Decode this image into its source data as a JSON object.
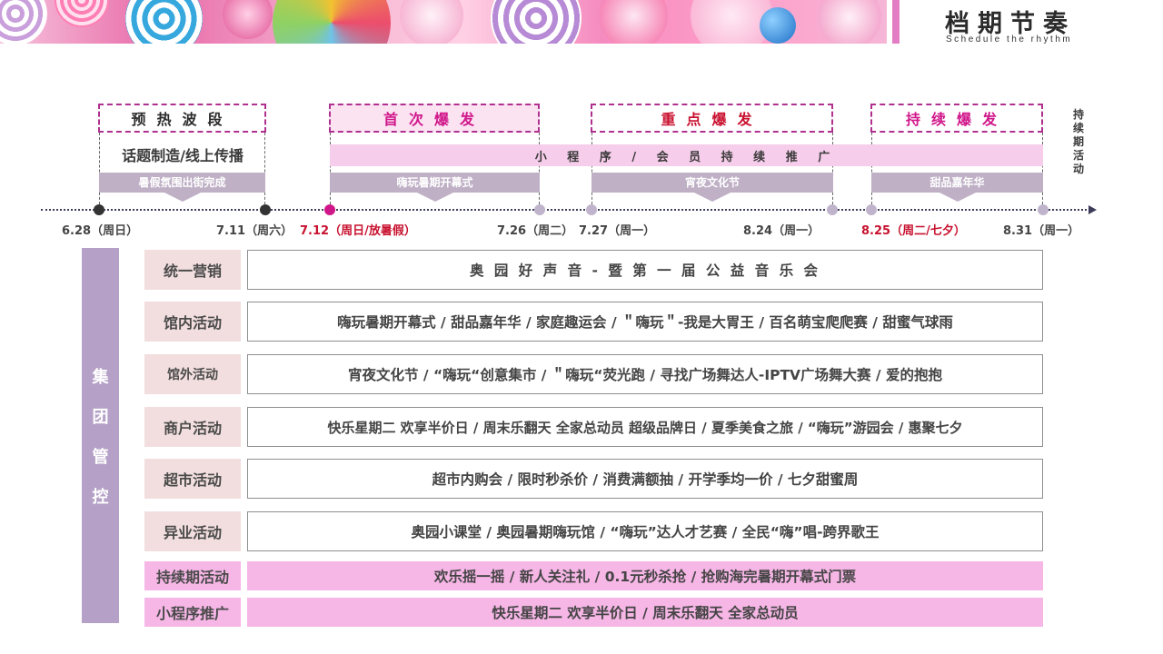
{
  "header": {
    "title": "档期节奏",
    "subtitle": "Schedule the rhythm"
  },
  "colors": {
    "accent_magenta": "#b0308f",
    "phase_text_red": "#c8102e",
    "phase_text_magenta": "#d0178a",
    "axis_dark": "#3b3b5a",
    "side_purple": "#b5a1c7",
    "tag_grey": "#bfb0c6",
    "row_label_bg": "#f2dede",
    "pink_row_bg": "#f6b6e6",
    "banner_bar": "#e37dc3"
  },
  "timeline": {
    "phases": [
      "预热波段",
      "首次爆发",
      "重点爆发",
      "持续爆发"
    ],
    "topic_text": "话题制造/线上传播",
    "miniapp_text": "小 程 序 / 会 员 持 续 推 广",
    "side_label": "持续期活动",
    "events": [
      "暑假氛围出街完成",
      "嗨玩暑期开幕式",
      "宵夜文化节",
      "甜品嘉年华"
    ],
    "dates": [
      "6.28（周日）",
      "7.11（周六）",
      "7.12（周日/放暑假）",
      "7.26（周二）",
      "7.27（周一）",
      "8.24（周一）",
      "8.25（周二/七夕）",
      "8.31（周一）"
    ]
  },
  "grid": {
    "side_title": [
      "集",
      "团",
      "管",
      "控"
    ],
    "rows": [
      {
        "label": "统一营销",
        "content": "奥 园 好 声 音 - 暨 第 一 届 公 益 音 乐 会"
      },
      {
        "label": "馆内活动",
        "content": "嗨玩暑期开幕式 / 甜品嘉年华 / 家庭趣运会 / ＂嗨玩＂-我是大胃王 / 百名萌宝爬爬赛 / 甜蜜气球雨"
      },
      {
        "label": "馆外活动",
        "content": "宵夜文化节 / “嗨玩“创意集市 / ＂嗨玩“荧光跑 / 寻找广场舞达人-IPTV广场舞大赛 / 爱的抱抱"
      },
      {
        "label": "商户活动",
        "content": "快乐星期二 欢享半价日 / 周末乐翻天 全家总动员 超级品牌日 / 夏季美食之旅 / “嗨玩”游园会 / 惠聚七夕"
      },
      {
        "label": "超市活动",
        "content": "超市内购会 / 限时秒杀价 / 消费满额抽 / 开学季均一价 / 七夕甜蜜周"
      },
      {
        "label": "异业活动",
        "content": "奥园小课堂 / 奥园暑期嗨玩馆 / “嗨玩”达人才艺赛 / 全民“嗨”唱-跨界歌王"
      },
      {
        "label": "持续期活动",
        "content": "欢乐摇一摇 / 新人关注礼 / 0.1元秒杀抢 / 抢购海完暑期开幕式门票"
      },
      {
        "label": "小程序推广",
        "content": "快乐星期二 欢享半价日 / 周末乐翻天 全家总动员"
      }
    ]
  }
}
